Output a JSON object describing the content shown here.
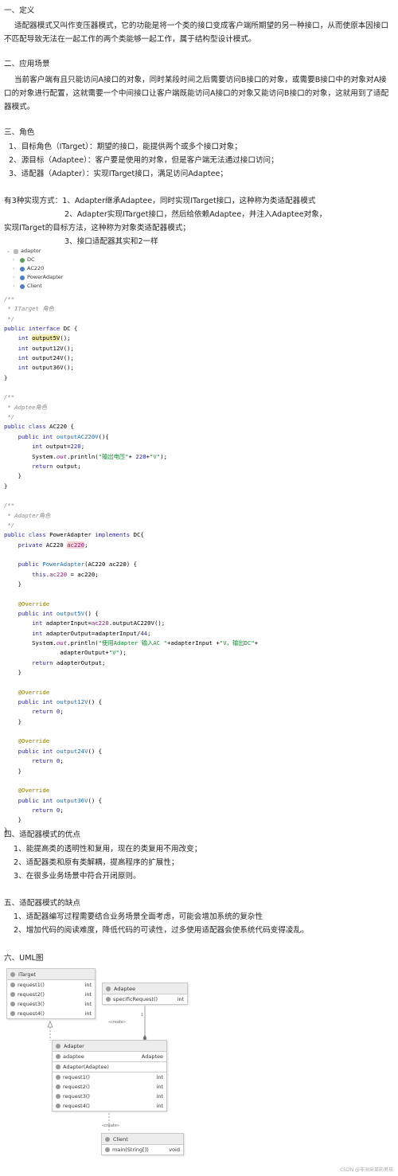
{
  "s1": {
    "heading": "一、定义",
    "p": "适配器模式又叫作变压器模式，它的功能是将一个类的接口变成客户端所期望的另一种接口，从而使原本因接口不匹配导致无法在一起工作的两个类能够一起工作，属于结构型设计模式。"
  },
  "s2": {
    "heading": "二、应用场景",
    "p": "当前客户端有且只能访问A接口的对象，同时某段时间之后需要访问B接口的对象，或需要B接口中的对象对A接口的对象进行配置，这就需要一个中间接口让客户端既能访问A接口的对象又能访问B接口的对象，这就用到了适配器模式。"
  },
  "s3": {
    "heading": "三、角色",
    "items": [
      "1、目标角色（ITarget）：期望的接口，能提供两个或多个接口对象；",
      "2、源目标（Adaptee）：客户要是使用的对象，但是客户端无法通过接口访问；",
      "3、适配器（Adapter）：实现ITarget接口，满足访问Adaptee；"
    ]
  },
  "impl": {
    "l1": "有3种实现方式：1、Adapter继承Adaptee，同时实现ITarget接口，这种称为类适配器模式",
    "l2": "2、Adapter实现ITarget接口，然后给依赖Adaptee，并注入Adaptee对象，",
    "l3": "实现ITarget的目标方法，这种称为对象类适配器模式；",
    "l4": "3、接口适配器其实和2一样"
  },
  "tree": {
    "root": "adaptor",
    "items": [
      {
        "name": "DC",
        "color": "#5aa05a"
      },
      {
        "name": "AC220",
        "color": "#4a7fd0"
      },
      {
        "name": "PowerAdapter",
        "color": "#4a7fd0"
      },
      {
        "name": "Client",
        "color": "#4a7fd0"
      }
    ]
  },
  "s4": {
    "heading": "四、适配器模式的优点",
    "items": [
      "1、能提高类的透明性和复用，现在的类复用不用改变；",
      "2、适配器类和原有类解耦，提高程序的扩展性；",
      "3、在很多业务场景中符合开闭原则。"
    ]
  },
  "s5": {
    "heading": "五、适配器模式的缺点",
    "items": [
      "1、适配器编写过程需要结合业务场景全面考虑，可能会增加系统的复杂性",
      "2、增加代码的阅读难度，降低代码的可读性，过多使用适配器会使系统代码变得凌乱。"
    ]
  },
  "s6": {
    "heading": "六、UML图"
  },
  "uml": {
    "itarget": {
      "title": "ITarget",
      "rows": [
        [
          "request1()",
          "int"
        ],
        [
          "request2()",
          "int"
        ],
        [
          "request3()",
          "int"
        ],
        [
          "request4()",
          "int"
        ]
      ]
    },
    "adaptee": {
      "title": "Adaptee",
      "rows": [
        [
          "specificRequest()",
          "int"
        ]
      ]
    },
    "adapter": {
      "title": "Adapter",
      "field": [
        "adaptee",
        "Adaptee"
      ],
      "ctor": "Adapter(Adaptee)",
      "rows": [
        [
          "request1()",
          "int"
        ],
        [
          "request2()",
          "int"
        ],
        [
          "request3()",
          "int"
        ],
        [
          "request4()",
          "int"
        ]
      ]
    },
    "client": {
      "title": "Client",
      "rows": [
        [
          "main(String[])",
          "void"
        ]
      ]
    },
    "create": "«create»",
    "one": "1"
  },
  "watermark": "CSDN @非洲采菜的男孩"
}
